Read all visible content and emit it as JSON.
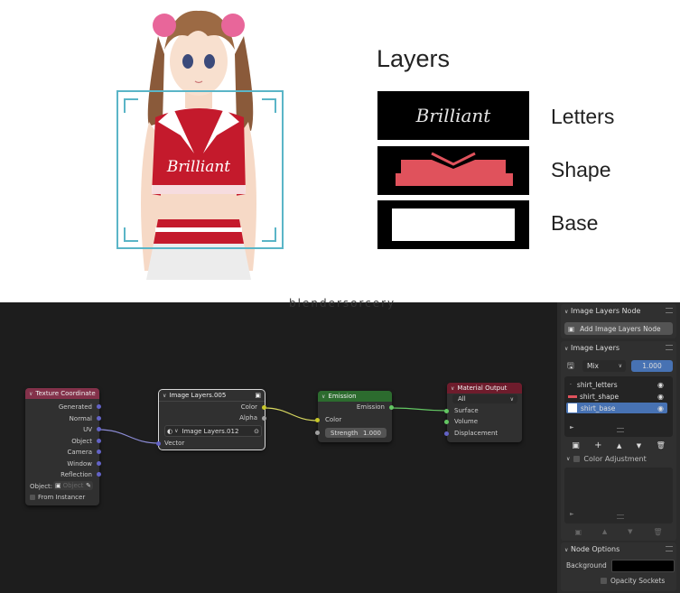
{
  "illustration": {
    "shirt_text": "Brilliant",
    "layers_title": "Layers",
    "layers": [
      {
        "swatch_text": "Brilliant",
        "label": "Letters"
      },
      {
        "swatch_text": "",
        "label": "Shape"
      },
      {
        "swatch_text": "",
        "label": "Base"
      }
    ]
  },
  "editor": {
    "watermark": "blendersorcery",
    "nodes": {
      "texture_coordinate": {
        "title": "Texture Coordinate",
        "outputs": [
          "Generated",
          "Normal",
          "UV",
          "Object",
          "Camera",
          "Window",
          "Reflection"
        ],
        "object_label": "Object:",
        "object_placeholder": "Object",
        "from_instancer": "From Instancer",
        "color": "#83314a"
      },
      "image_layers": {
        "title": "Image Layers.005",
        "outputs": [
          "Color",
          "Alpha"
        ],
        "datablock": "Image Layers.012",
        "input": "Vector",
        "color": "#303030"
      },
      "emission": {
        "title": "Emission",
        "output": "Emission",
        "input_color": "Color",
        "strength_label": "Strength",
        "strength_value": "1.000",
        "color": "#2c6b2e"
      },
      "material_output": {
        "title": "Material Output",
        "target": "All",
        "inputs": [
          "Surface",
          "Volume",
          "Displacement"
        ],
        "color": "#6e1c2c"
      }
    }
  },
  "sidebar": {
    "image_layers_node": {
      "header": "Image Layers Node",
      "add_button": "Add Image Layers Node"
    },
    "image_layers": {
      "header": "Image Layers",
      "blend_mode": "Mix",
      "factor": "1.000",
      "items": [
        {
          "label": "shirt_letters",
          "active": false
        },
        {
          "label": "shirt_shape",
          "active": false
        },
        {
          "label": "shirt_base",
          "active": true
        }
      ],
      "toolbar": [
        "save-layer",
        "+",
        "▲",
        "▼",
        "trash"
      ],
      "color_adjustment": "Color Adjustment"
    },
    "node_options": {
      "header": "Node Options",
      "background_label": "Background",
      "background_color": "#000000",
      "opacity_sockets": "Opacity Sockets"
    }
  }
}
